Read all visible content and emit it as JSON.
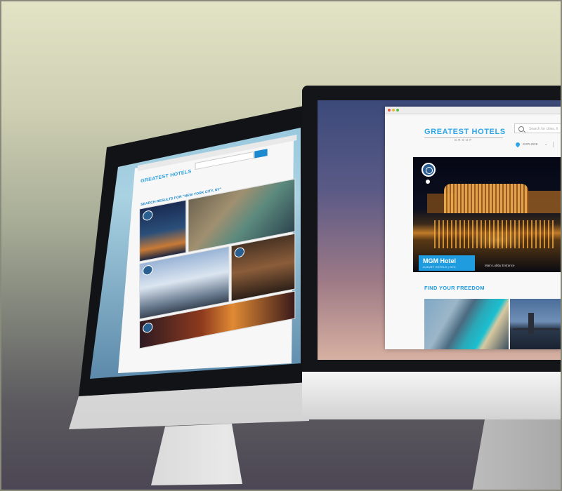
{
  "right_site": {
    "brand": "GREATEST HOTELS",
    "brand_sub": "GROUP",
    "search_placeholder": "Search for cities, h",
    "location_label": "EXPLORE",
    "hero": {
      "title": "MGM Hotel",
      "subtitle": "LUXURY HOTELS | NYC",
      "caption": "Main Lobby Entrance"
    },
    "section_heading": "FIND YOUR FREEDOM"
  },
  "left_site": {
    "brand": "GREATEST HOTELS",
    "brand_sub": "GROUP",
    "results_heading": "SEARCH RESULTS FOR \"NEW YORK CITY, NY\""
  },
  "colors": {
    "accent": "#1f9be0",
    "brand": "#2ea6e6"
  }
}
